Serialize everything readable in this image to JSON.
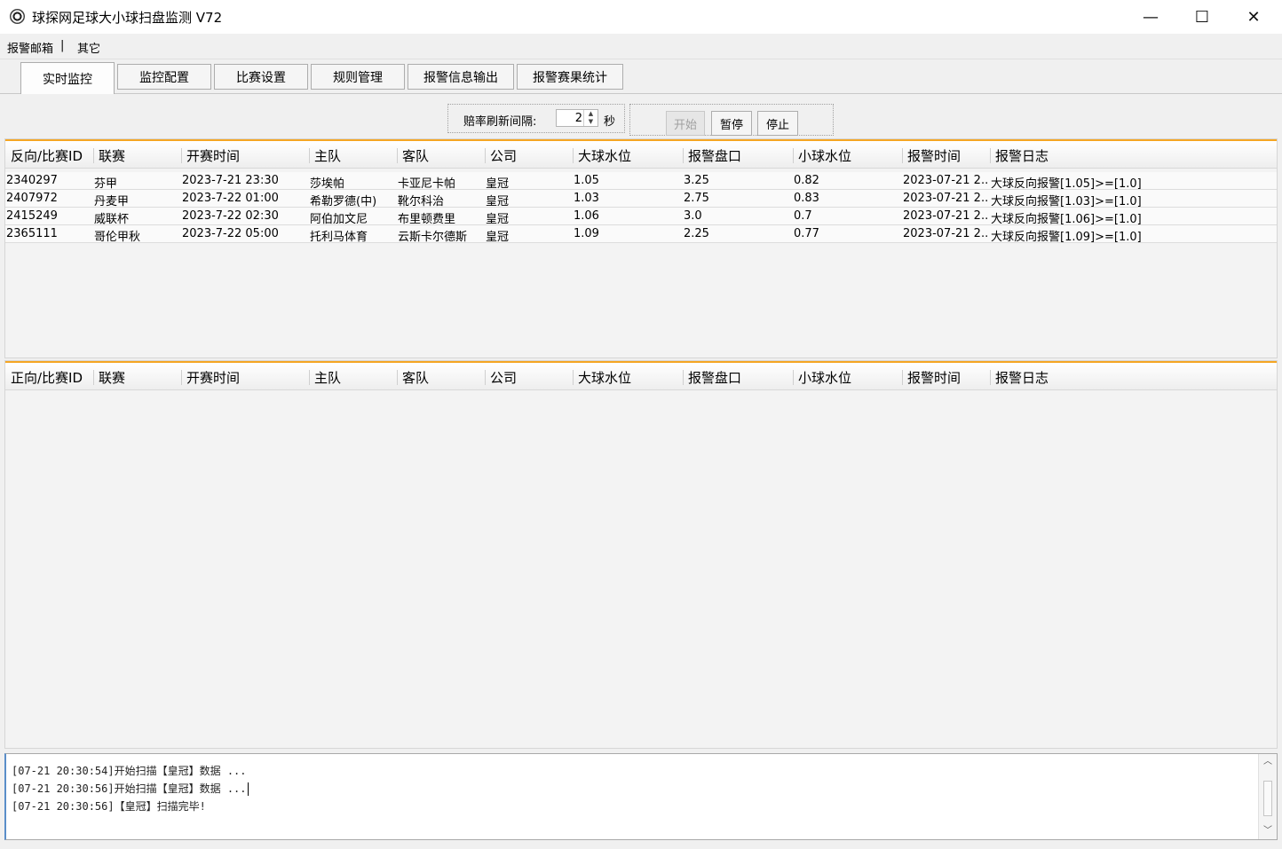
{
  "window": {
    "title": "球探网足球大小球扫盘监测 V72",
    "minimize": "—",
    "maximize": "☐",
    "close": "✕"
  },
  "menu": {
    "items": [
      {
        "label": "报警邮箱"
      },
      {
        "label": "|"
      },
      {
        "label": "其它"
      }
    ]
  },
  "tabs": [
    {
      "label": "实时监控",
      "active": true
    },
    {
      "label": "监控配置"
    },
    {
      "label": "比赛设置"
    },
    {
      "label": "规则管理"
    },
    {
      "label": "报警信息输出"
    },
    {
      "label": "报警赛果统计"
    }
  ],
  "refresh": {
    "label": "赔率刷新间隔:",
    "value": "2",
    "unit": "秒",
    "up_arrow": "▲",
    "down_arrow": "▼"
  },
  "controls": {
    "start": "开始",
    "pause": "暂停",
    "stop": "停止"
  },
  "reverse_grid": {
    "columns": [
      "反向/比赛ID",
      "联赛",
      "开赛时间",
      "主队",
      "客队",
      "公司",
      "大球水位",
      "报警盘口",
      "小球水位",
      "报警时间",
      "报警日志"
    ],
    "rows": [
      [
        "2340297",
        "芬甲",
        "2023-7-21 23:30",
        "莎埃帕",
        "卡亚尼卡帕",
        "皇冠",
        "1.05",
        "3.25",
        "0.82",
        "2023-07-21 2...",
        "大球反向报警[1.05]>=[1.0]"
      ],
      [
        "2407972",
        "丹麦甲",
        "2023-7-22 01:00",
        "希勒罗德(中)",
        "靴尔科治",
        "皇冠",
        "1.03",
        "2.75",
        "0.83",
        "2023-07-21 2...",
        "大球反向报警[1.03]>=[1.0]"
      ],
      [
        "2415249",
        "威联杯",
        "2023-7-22 02:30",
        "阿伯加文尼",
        "布里顿费里",
        "皇冠",
        "1.06",
        "3.0",
        "0.7",
        "2023-07-21 2...",
        "大球反向报警[1.06]>=[1.0]"
      ],
      [
        "2365111",
        "哥伦甲秋",
        "2023-7-22 05:00",
        "托利马体育",
        "云斯卡尔德斯",
        "皇冠",
        "1.09",
        "2.25",
        "0.77",
        "2023-07-21 2...",
        "大球反向报警[1.09]>=[1.0]"
      ]
    ]
  },
  "forward_grid": {
    "columns": [
      "正向/比赛ID",
      "联赛",
      "开赛时间",
      "主队",
      "客队",
      "公司",
      "大球水位",
      "报警盘口",
      "小球水位",
      "报警时间",
      "报警日志"
    ],
    "rows": []
  },
  "log": {
    "lines": [
      "[07-21 20:30:54]开始扫描【皇冠】数据 ...",
      "[07-21 20:30:56]开始扫描【皇冠】数据 ...",
      "[07-21 20:30:56]【皇冠】扫描完毕!"
    ],
    "scroll_up": "︿",
    "scroll_down": "﹀"
  }
}
